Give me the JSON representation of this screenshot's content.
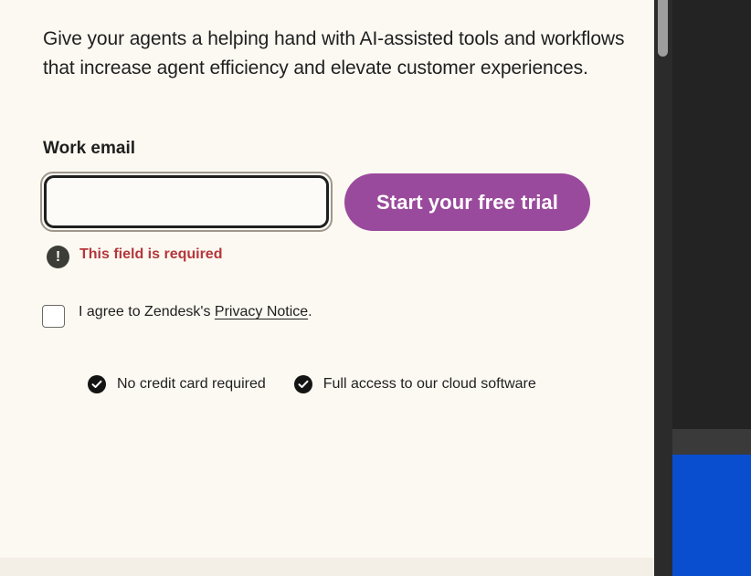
{
  "intro": {
    "text": "Give your agents a helping hand with AI-assisted tools and workflows that increase agent efficiency and elevate customer experiences."
  },
  "form": {
    "email_label": "Work email",
    "email_value": "",
    "email_placeholder": "",
    "submit_label": "Start your free trial",
    "error_icon": "!",
    "error_text": "This field is required",
    "consent_prefix": "I agree to Zendesk's ",
    "consent_link": "Privacy Notice",
    "consent_suffix": ".",
    "consent_checked": false
  },
  "perks": [
    {
      "icon": "check-icon",
      "text": "No credit card required"
    },
    {
      "icon": "check-icon",
      "text": "Full access to our cloud software"
    }
  ],
  "colors": {
    "panel_bg": "#fcf9f2",
    "button_bg": "#9a4a9c",
    "error": "#b5363a",
    "text": "#1f1f1f",
    "right_blue": "#0a4ed0"
  }
}
